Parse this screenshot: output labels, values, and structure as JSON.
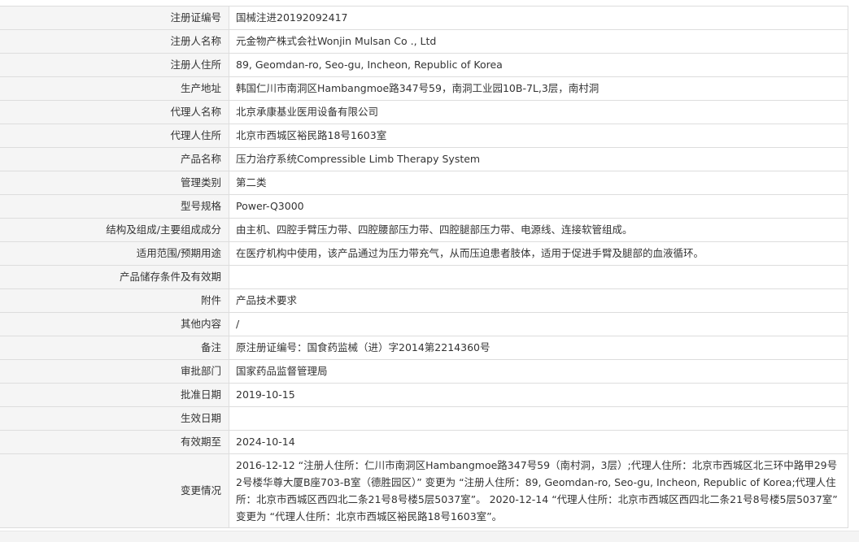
{
  "rows": [
    {
      "label": "注册证编号",
      "value": "国械注进20192092417"
    },
    {
      "label": "注册人名称",
      "value": "元金物产株式会社Wonjin Mulsan Co ., Ltd"
    },
    {
      "label": "注册人住所",
      "value": "89, Geomdan-ro, Seo-gu, Incheon, Republic of Korea"
    },
    {
      "label": "生产地址",
      "value": "韩国仁川市南洞区Hambangmoe路347号59，南洞工业园10B-7L,3层，南村洞"
    },
    {
      "label": "代理人名称",
      "value": "北京承康基业医用设备有限公司"
    },
    {
      "label": "代理人住所",
      "value": "北京市西城区裕民路18号1603室"
    },
    {
      "label": "产品名称",
      "value": "压力治疗系统Compressible Limb Therapy System"
    },
    {
      "label": "管理类别",
      "value": "第二类"
    },
    {
      "label": "型号规格",
      "value": "Power-Q3000"
    },
    {
      "label": "结构及组成/主要组成成分",
      "value": "由主机、四腔手臂压力带、四腔腰部压力带、四腔腿部压力带、电源线、连接软管组成。"
    },
    {
      "label": "适用范围/预期用途",
      "value": "在医疗机构中使用，该产品通过为压力带充气，从而压迫患者肢体，适用于促进手臂及腿部的血液循环。"
    },
    {
      "label": "产品储存条件及有效期",
      "value": ""
    },
    {
      "label": "附件",
      "value": "产品技术要求"
    },
    {
      "label": "其他内容",
      "value": "/"
    },
    {
      "label": "备注",
      "value": "原注册证编号：国食药监械（进）字2014第2214360号"
    },
    {
      "label": "审批部门",
      "value": "国家药品监督管理局"
    },
    {
      "label": "批准日期",
      "value": "2019-10-15"
    },
    {
      "label": "生效日期",
      "value": ""
    },
    {
      "label": "有效期至",
      "value": "2024-10-14"
    },
    {
      "label": "变更情况",
      "value": "2016-12-12 “注册人住所：仁川市南洞区Hambangmoe路347号59（南村洞，3层）;代理人住所：北京市西城区北三环中路甲29号2号楼华尊大厦B座703-B室（德胜园区）” 变更为 “注册人住所：89, Geomdan-ro, Seo-gu, Incheon, Republic of Korea;代理人住所：北京市西城区西四北二条21号8号楼5层5037室”。 2020-12-14 “代理人住所：北京市西城区西四北二条21号8号楼5层5037室” 变更为 “代理人住所：北京市西城区裕民路18号1603室”。"
    }
  ]
}
